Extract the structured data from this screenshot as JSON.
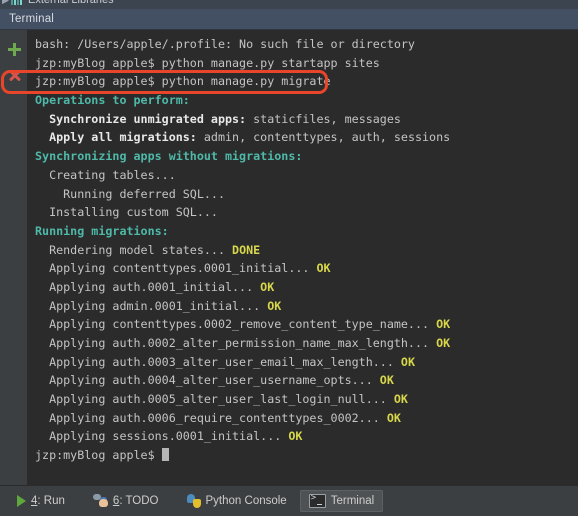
{
  "project_tree": {
    "row_label": "External Libraries",
    "arrow": "▶",
    "icon": "library-icon"
  },
  "tab_header": {
    "tab_label": "Terminal"
  },
  "gutter": {
    "new_session_label": "+",
    "close_session_label": "×"
  },
  "annotation": {
    "color": "#e8452a",
    "target_text": "jzp:myBlog apple$ python manage.py migrate"
  },
  "terminal": {
    "prompt": "jzp:myBlog apple$",
    "lines": [
      {
        "segments": [
          {
            "text": "bash: /Users/apple/.profile: No such file or directory",
            "style": "plain"
          }
        ]
      },
      {
        "segments": [
          {
            "text": "jzp:myBlog apple$ python manage.py startapp sites",
            "style": "plain"
          }
        ]
      },
      {
        "segments": [
          {
            "text": "jzp:myBlog apple$ python manage.py migrate",
            "style": "plain"
          }
        ]
      },
      {
        "segments": [
          {
            "text": "Operations to perform:",
            "style": "header"
          }
        ]
      },
      {
        "segments": [
          {
            "text": "  Synchronize unmigrated apps:",
            "style": "strong"
          },
          {
            "text": " staticfiles, messages",
            "style": "plain"
          }
        ]
      },
      {
        "segments": [
          {
            "text": "  Apply all migrations:",
            "style": "strong"
          },
          {
            "text": " admin, contenttypes, auth, sessions",
            "style": "plain"
          }
        ]
      },
      {
        "segments": [
          {
            "text": "Synchronizing apps without migrations:",
            "style": "header"
          }
        ]
      },
      {
        "segments": [
          {
            "text": "  Creating tables...",
            "style": "plain"
          }
        ]
      },
      {
        "segments": [
          {
            "text": "    Running deferred SQL...",
            "style": "plain"
          }
        ]
      },
      {
        "segments": [
          {
            "text": "  Installing custom SQL...",
            "style": "plain"
          }
        ]
      },
      {
        "segments": [
          {
            "text": "Running migrations:",
            "style": "header"
          }
        ]
      },
      {
        "segments": [
          {
            "text": "  Rendering model states...",
            "style": "plain"
          },
          {
            "text": " DONE",
            "style": "ok"
          }
        ]
      },
      {
        "segments": [
          {
            "text": "  Applying contenttypes.0001_initial...",
            "style": "plain"
          },
          {
            "text": " OK",
            "style": "ok"
          }
        ]
      },
      {
        "segments": [
          {
            "text": "  Applying auth.0001_initial...",
            "style": "plain"
          },
          {
            "text": " OK",
            "style": "ok"
          }
        ]
      },
      {
        "segments": [
          {
            "text": "  Applying admin.0001_initial...",
            "style": "plain"
          },
          {
            "text": " OK",
            "style": "ok"
          }
        ]
      },
      {
        "segments": [
          {
            "text": "  Applying contenttypes.0002_remove_content_type_name...",
            "style": "plain"
          },
          {
            "text": " OK",
            "style": "ok"
          }
        ]
      },
      {
        "segments": [
          {
            "text": "  Applying auth.0002_alter_permission_name_max_length...",
            "style": "plain"
          },
          {
            "text": " OK",
            "style": "ok"
          }
        ]
      },
      {
        "segments": [
          {
            "text": "  Applying auth.0003_alter_user_email_max_length...",
            "style": "plain"
          },
          {
            "text": " OK",
            "style": "ok"
          }
        ]
      },
      {
        "segments": [
          {
            "text": "  Applying auth.0004_alter_user_username_opts...",
            "style": "plain"
          },
          {
            "text": " OK",
            "style": "ok"
          }
        ]
      },
      {
        "segments": [
          {
            "text": "  Applying auth.0005_alter_user_last_login_null...",
            "style": "plain"
          },
          {
            "text": " OK",
            "style": "ok"
          }
        ]
      },
      {
        "segments": [
          {
            "text": "  Applying auth.0006_require_contenttypes_0002...",
            "style": "plain"
          },
          {
            "text": " OK",
            "style": "ok"
          }
        ]
      },
      {
        "segments": [
          {
            "text": "  Applying sessions.0001_initial...",
            "style": "plain"
          },
          {
            "text": " OK",
            "style": "ok"
          }
        ]
      },
      {
        "segments": [
          {
            "text": "jzp:myBlog apple$ ",
            "style": "plain"
          },
          {
            "text": "",
            "style": "cursor"
          }
        ]
      }
    ]
  },
  "statusbar": {
    "items": [
      {
        "icon": "play-icon",
        "mnemonic": "4",
        "label": ": Run",
        "active": false
      },
      {
        "icon": "todo-icon",
        "mnemonic": "6",
        "label": ": TODO",
        "active": false
      },
      {
        "icon": "python-icon",
        "mnemonic": "",
        "label": "Python Console",
        "active": false
      },
      {
        "icon": "console-icon",
        "mnemonic": "",
        "label": "Terminal",
        "active": true
      }
    ]
  }
}
